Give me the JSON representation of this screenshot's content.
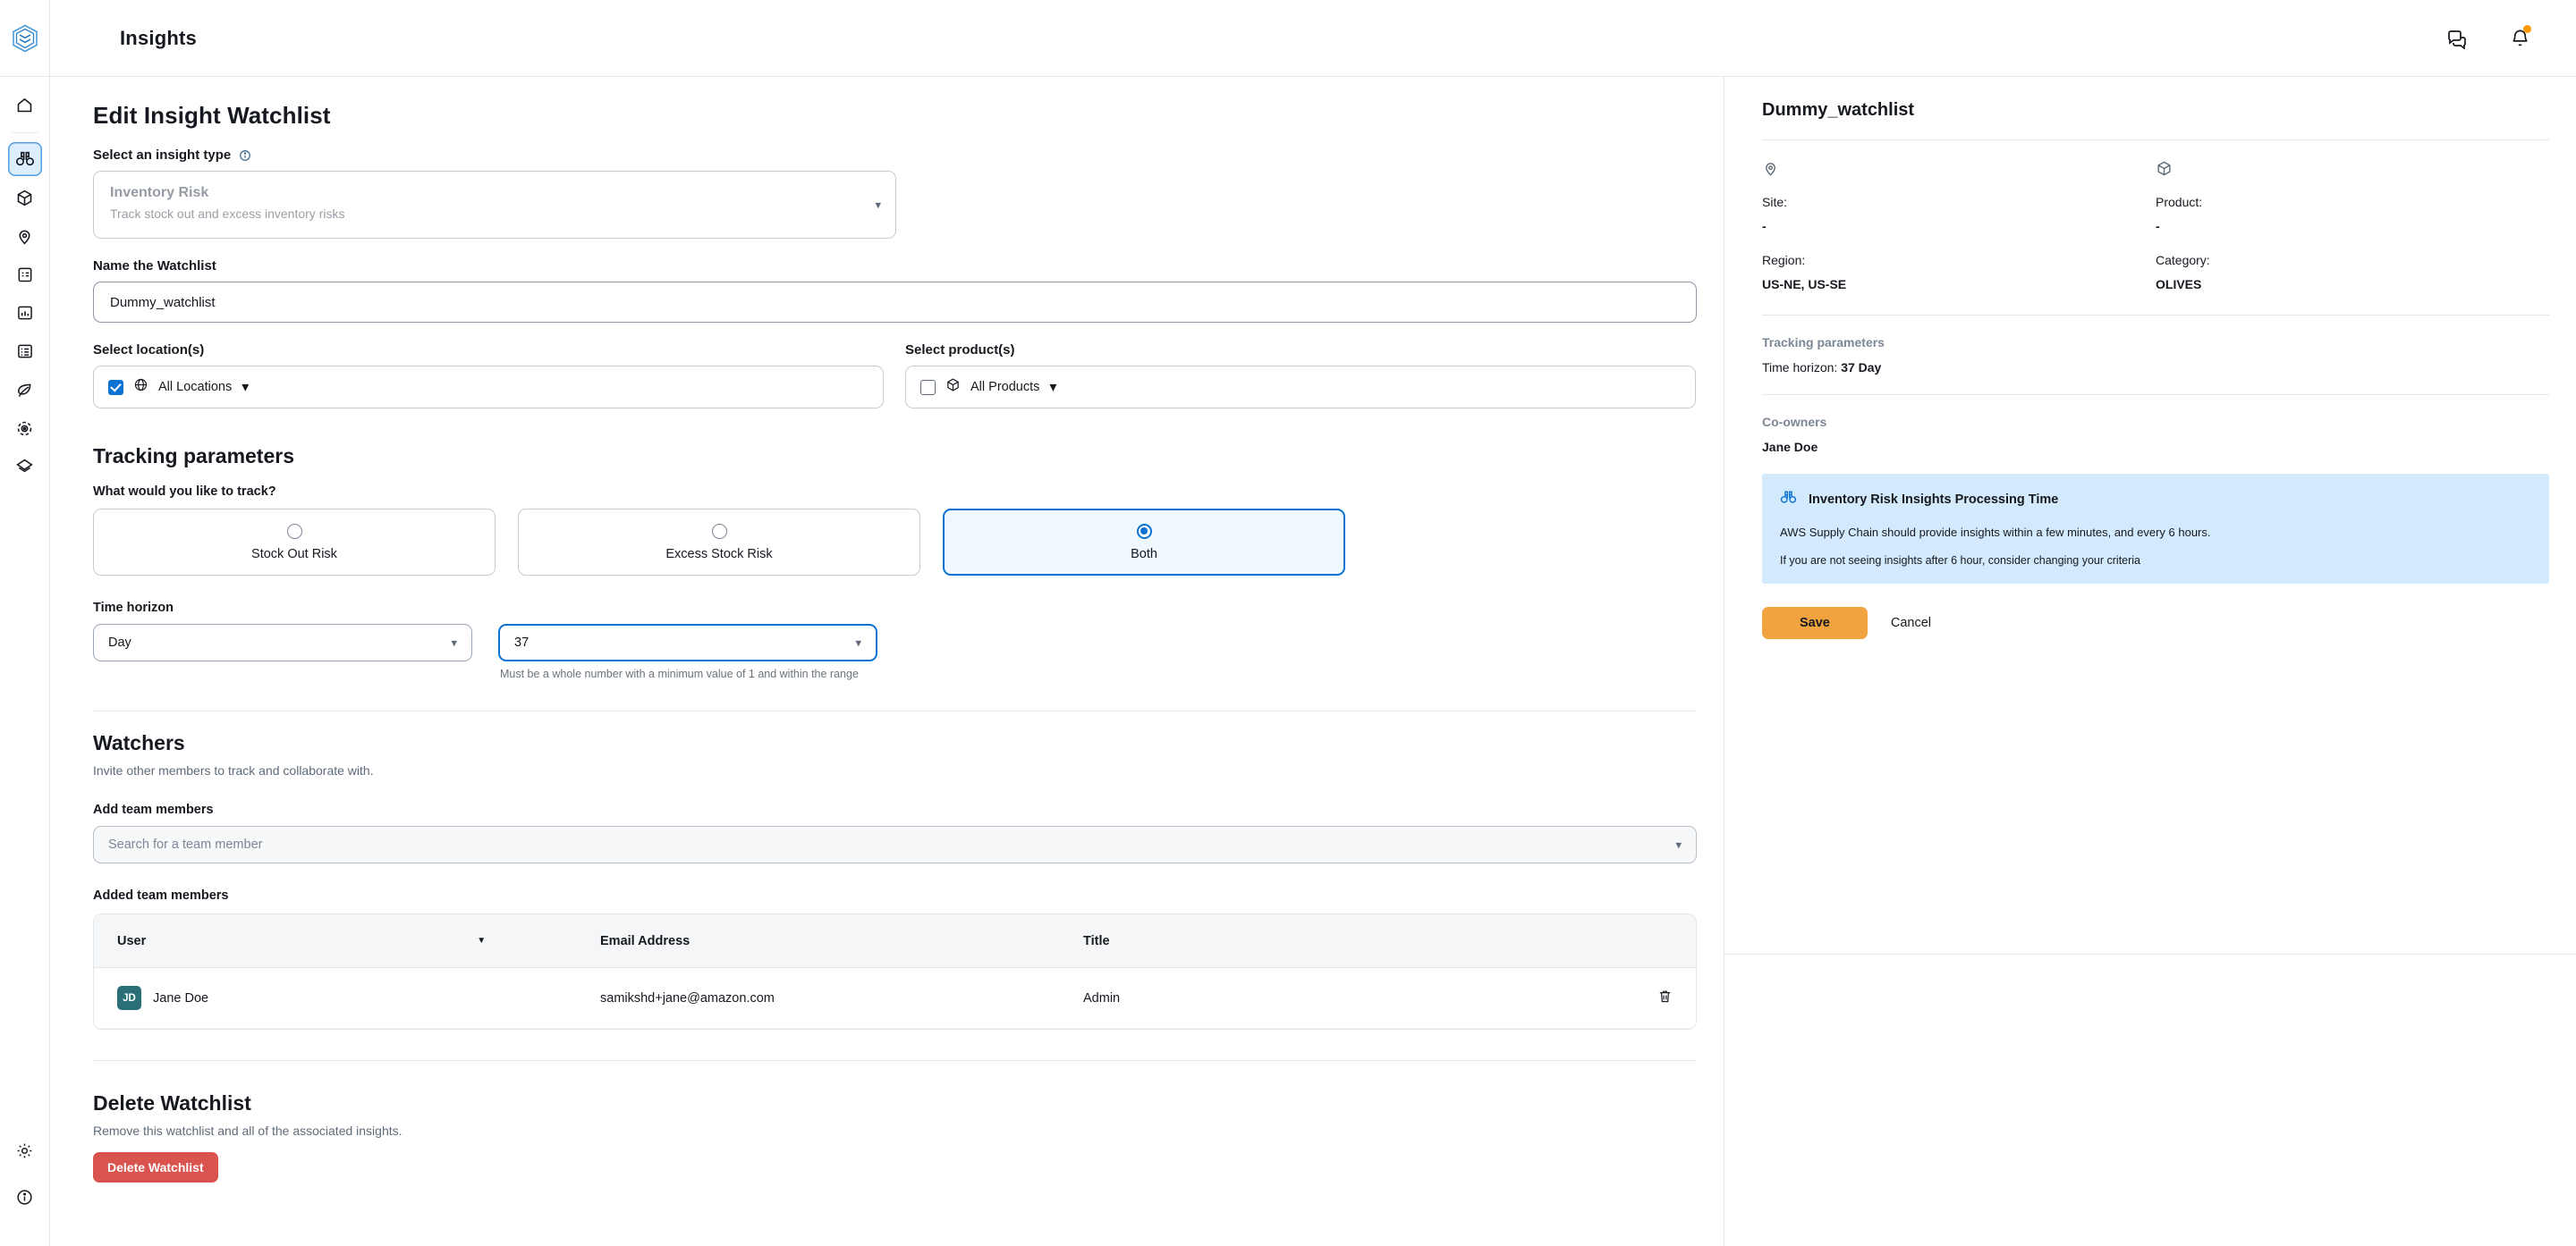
{
  "topbar": {
    "app_title": "Insights",
    "logo_icon": "aws-supply-chain-cube-logo",
    "icons": [
      {
        "name": "chat-support-icon",
        "glyph": "chat"
      },
      {
        "name": "notifications-bell-icon",
        "glyph": "bell"
      }
    ]
  },
  "sidebar": {
    "items": [
      {
        "label": "Home",
        "icon": "home-icon",
        "active": false
      },
      {
        "label": "Insights",
        "icon": "binoculars-icon",
        "active": true
      },
      {
        "label": "Inventory",
        "icon": "box-icon",
        "active": false
      },
      {
        "label": "Network",
        "icon": "location-pin-icon",
        "active": false
      },
      {
        "label": "Plans",
        "icon": "clipboard-list-icon",
        "active": false
      },
      {
        "label": "Demand Planning",
        "icon": "bar-chart-icon",
        "active": false
      },
      {
        "label": "Work Orders",
        "icon": "task-list-icon",
        "active": false
      },
      {
        "label": "Sustainability",
        "icon": "leaf-icon",
        "active": false
      },
      {
        "label": "Supply Planning",
        "icon": "target-icon",
        "active": false
      },
      {
        "label": "Data Lake",
        "icon": "layers-icon",
        "active": false
      }
    ],
    "bottom_items": [
      {
        "label": "Settings",
        "icon": "gear-icon"
      },
      {
        "label": "Help",
        "icon": "info-circle-icon"
      }
    ]
  },
  "form": {
    "page_title": "Edit Insight Watchlist",
    "insight_type": {
      "label": "Select an insight type",
      "info_icon": "info-circle-icon",
      "value_title": "Inventory Risk",
      "value_subtitle": "Track stock out and excess inventory risks",
      "caret_icon": "chevron-down-icon"
    },
    "watchlist_name": {
      "label": "Name the Watchlist",
      "value": "Dummy_watchlist",
      "placeholder": "Name the Watchlist"
    },
    "locations": {
      "label": "Select location(s)",
      "option_label": "All Locations",
      "checked": true,
      "icon": "globe-location-icon",
      "caret_icon": "chevron-down-icon"
    },
    "products": {
      "label": "Select product(s)",
      "option_label": "All Products",
      "checked": false,
      "icon": "product-box-icon",
      "caret_icon": "chevron-down-icon"
    },
    "tracking": {
      "section_title": "Tracking parameters",
      "question": "What would you like to track?",
      "options": [
        {
          "label": "Stock Out Risk",
          "selected": false
        },
        {
          "label": "Excess Stock Risk",
          "selected": false
        },
        {
          "label": "Both",
          "selected": true
        }
      ],
      "time_horizon_label": "Time horizon",
      "unit_value": "Day",
      "number_value": "37",
      "helper_text": "Must be a whole number with a minimum value of 1 and within the range"
    },
    "watchers": {
      "section_title": "Watchers",
      "section_sub": "Invite other members to track and collaborate with.",
      "add_label": "Add team members",
      "search_placeholder": "Search for a team member",
      "caret_icon": "chevron-down-icon",
      "added_label": "Added team members",
      "columns": [
        "User",
        "Email Address",
        "Title"
      ],
      "sort_icon": "sort-descending-caret-icon",
      "rows": [
        {
          "initials": "JD",
          "user": "Jane Doe",
          "email": "samikshd+jane@amazon.com",
          "title": "Admin",
          "delete_icon": "trash-icon"
        }
      ]
    },
    "delete": {
      "section_title": "Delete Watchlist",
      "section_sub": "Remove this watchlist and all of the associated insights.",
      "button_label": "Delete Watchlist"
    }
  },
  "side_panel": {
    "title": "Dummy_watchlist",
    "site_icon": "location-pin-icon",
    "product_icon": "product-box-icon",
    "site_key": "Site:",
    "site_value": "-",
    "product_key": "Product:",
    "product_value": "-",
    "region_key": "Region:",
    "region_value": "US-NE, US-SE",
    "category_key": "Category:",
    "category_value": "OLIVES",
    "tracking_label": "Tracking parameters",
    "time_horizon_prefix": "Time horizon: ",
    "time_horizon_value": "37 Day",
    "co_owners_label": "Co-owners",
    "co_owners_value": "Jane Doe",
    "callout": {
      "icon": "binoculars-icon",
      "title": "Inventory Risk Insights Processing Time",
      "line1": "AWS Supply Chain should provide insights within a few minutes, and every 6 hours.",
      "line2": "If you are not seeing insights after 6 hour, consider changing your criteria"
    },
    "save_label": "Save",
    "cancel_label": "Cancel"
  },
  "colors": {
    "accent_blue": "#0972d3",
    "save_orange": "#f0a33f",
    "danger_red": "#d9544f",
    "callout_bg": "#d3eafd",
    "avatar_teal": "#2a6f77"
  }
}
